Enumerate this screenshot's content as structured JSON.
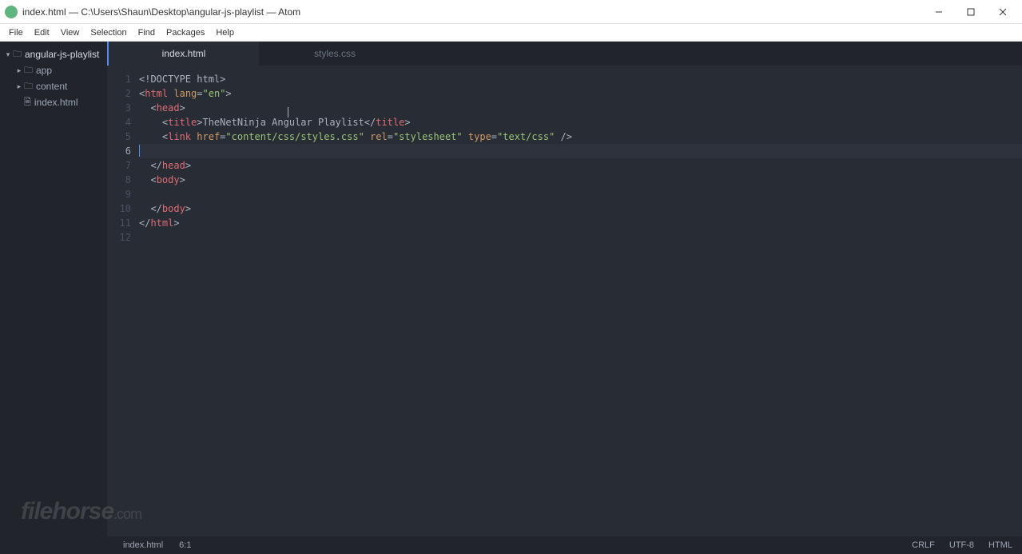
{
  "title": "index.html — C:\\Users\\Shaun\\Desktop\\angular-js-playlist — Atom",
  "menu": [
    "File",
    "Edit",
    "View",
    "Selection",
    "Find",
    "Packages",
    "Help"
  ],
  "tree": {
    "root": "angular-js-playlist",
    "items": [
      {
        "label": "app",
        "type": "folder"
      },
      {
        "label": "content",
        "type": "folder"
      },
      {
        "label": "index.html",
        "type": "file"
      }
    ]
  },
  "tabs": [
    {
      "label": "index.html",
      "active": true
    },
    {
      "label": "styles.css",
      "active": false
    }
  ],
  "lines": [
    1,
    2,
    3,
    4,
    5,
    6,
    7,
    8,
    9,
    10,
    11,
    12
  ],
  "current_line": 6,
  "code": {
    "l1": {
      "a": "<!DOCTYPE html>"
    },
    "l2": {
      "a": "<",
      "b": "html",
      "c": " ",
      "d": "lang",
      "e": "=",
      "f": "\"en\"",
      "g": ">"
    },
    "l3": {
      "a": "  <",
      "b": "head",
      "c": ">"
    },
    "l4": {
      "a": "    <",
      "b": "title",
      "c": ">",
      "d": "TheNetNinja Angular Playlist",
      "e": "</",
      "f": "title",
      "g": ">"
    },
    "l5": {
      "a": "    <",
      "b": "link",
      "c": " ",
      "d": "href",
      "e": "=",
      "f": "\"content/css/styles.css\"",
      "g": " ",
      "h": "rel",
      "i": "=",
      "j": "\"stylesheet\"",
      "k": " ",
      "l": "type",
      "m": "=",
      "n": "\"text/css\"",
      "o": " />"
    },
    "l7": {
      "a": "  </",
      "b": "head",
      "c": ">"
    },
    "l8": {
      "a": "  <",
      "b": "body",
      "c": ">"
    },
    "l10": {
      "a": "  </",
      "b": "body",
      "c": ">"
    },
    "l11": {
      "a": "</",
      "b": "html",
      "c": ">"
    }
  },
  "status": {
    "file": "index.html",
    "pos": "6:1",
    "eol": "CRLF",
    "enc": "UTF-8",
    "lang": "HTML"
  },
  "watermark": "filehorse",
  "watermark_suffix": ".com"
}
